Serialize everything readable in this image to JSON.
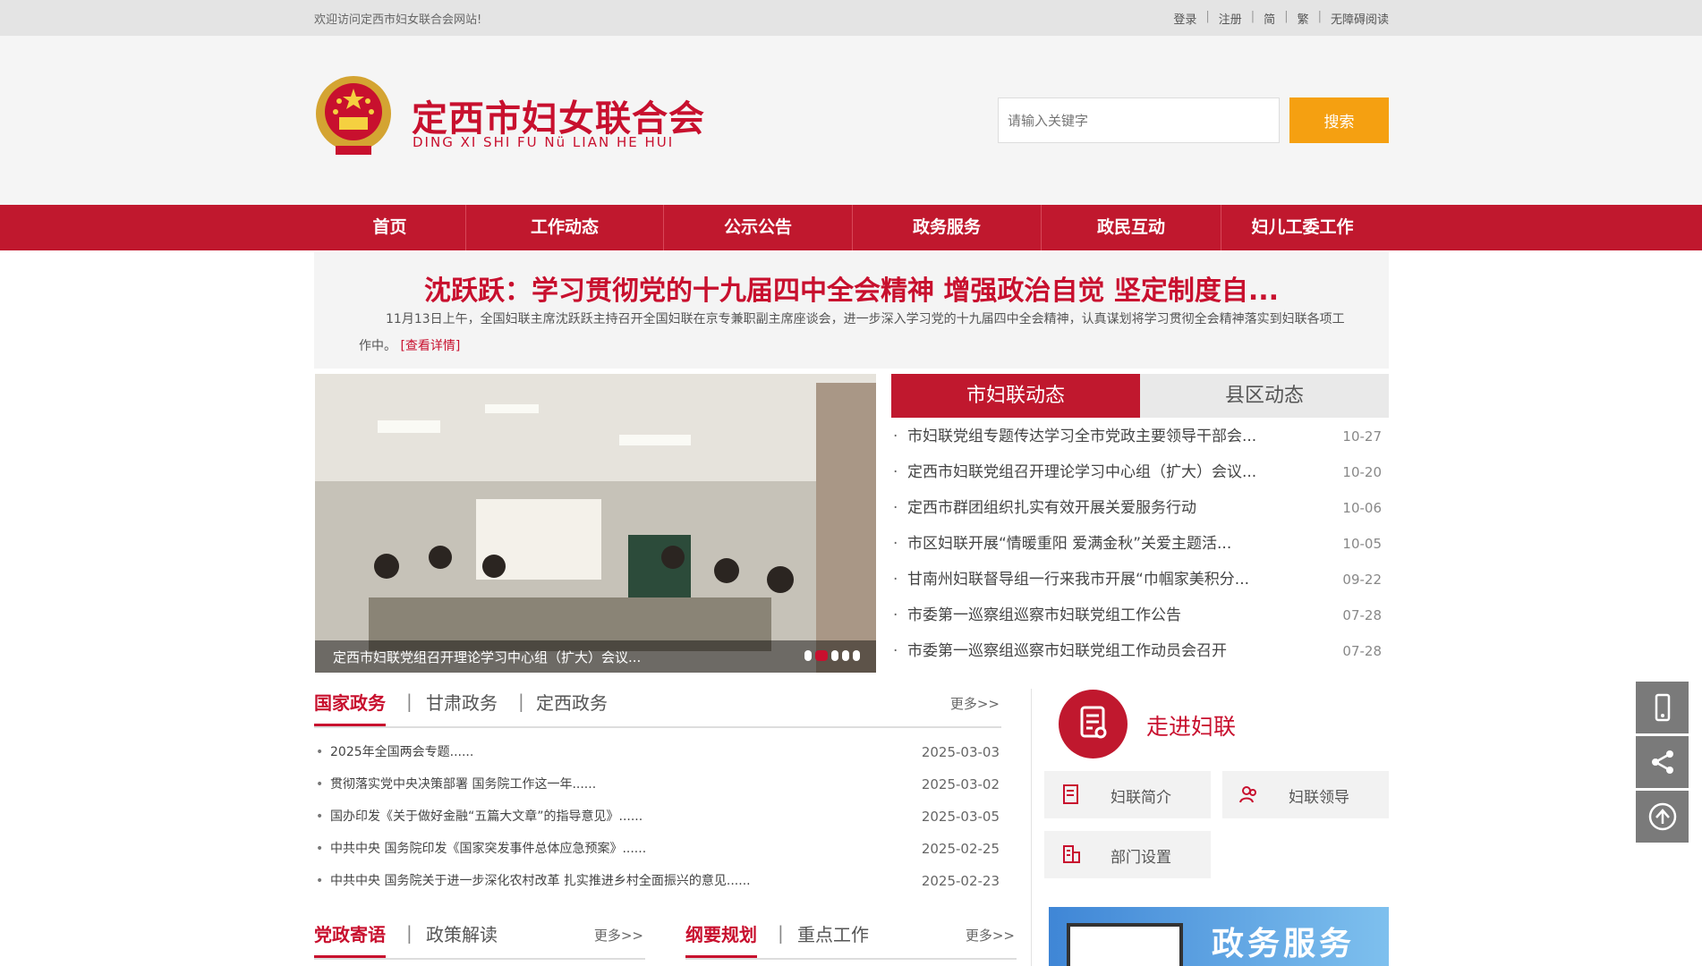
{
  "topbar": {
    "welcome": "欢迎访问定西市妇女联合会网站!",
    "links": [
      "登录",
      "注册",
      "简",
      "繁",
      "无障碍阅读"
    ]
  },
  "header": {
    "title": "定西市妇女联合会",
    "subtitle": "DING XI SHI FU Nü LIAN HE HUI",
    "search_placeholder": "请输入关键字",
    "search_button": "搜索"
  },
  "nav": {
    "items": [
      "首页",
      "工作动态",
      "公示公告",
      "政务服务",
      "政民互动",
      "妇儿工委工作"
    ]
  },
  "headline": {
    "title": "沈跃跃：学习贯彻党的十九届四中全会精神 增强政治自觉 坚定制度自...",
    "summary": "11月13日上午，全国妇联主席沈跃跃主持召开全国妇联在京专兼职副主席座谈会，进一步深入学习党的十九届四中全会精神，认真谋划将学习贯彻全会精神落实到妇联各项工作中。",
    "more": "[查看详情]"
  },
  "slider": {
    "caption": "定西市妇联党组召开理论学习中心组（扩大）会议..."
  },
  "news_tabs": {
    "tabs": [
      "市妇联动态",
      "县区动态"
    ],
    "items": [
      {
        "title": "市妇联党组专题传达学习全市党政主要领导干部会...",
        "date": "10-27"
      },
      {
        "title": "定西市妇联党组召开理论学习中心组（扩大）会议...",
        "date": "10-20"
      },
      {
        "title": "定西市群团组织扎实有效开展关爱服务行动",
        "date": "10-06"
      },
      {
        "title": "市区妇联开展“情暖重阳 爱满金秋”关爱主题活...",
        "date": "10-05"
      },
      {
        "title": "甘南州妇联督导组一行来我市开展“巾帼家美积分...",
        "date": "09-22"
      },
      {
        "title": "市委第一巡察组巡察市妇联党组工作公告",
        "date": "07-28"
      },
      {
        "title": "市委第一巡察组巡察市妇联党组工作动员会召开",
        "date": "07-28"
      }
    ]
  },
  "gov": {
    "tabs": [
      "国家政务",
      "甘肃政务",
      "定西政务"
    ],
    "more": "更多>>",
    "items": [
      {
        "title": "2025年全国两会专题......",
        "date": "2025-03-03"
      },
      {
        "title": "贯彻落实党中央决策部署 国务院工作这一年......",
        "date": "2025-03-02"
      },
      {
        "title": "国办印发《关于做好金融“五篇大文章”的指导意见》......",
        "date": "2025-03-05"
      },
      {
        "title": "中共中央  国务院印发《国家突发事件总体应急预案》......",
        "date": "2025-02-25"
      },
      {
        "title": "中共中央 国务院关于进一步深化农村改革 扎实推进乡村全面振兴的意见......",
        "date": "2025-02-23"
      }
    ]
  },
  "bottom": {
    "left_tabs": [
      "党政寄语",
      "政策解读"
    ],
    "right_tabs": [
      "纲要规划",
      "重点工作"
    ],
    "more": "更多>>"
  },
  "zoujin": {
    "title": "走进妇联",
    "buttons": [
      "妇联简介",
      "妇联领导",
      "部门设置"
    ]
  },
  "gov_service": {
    "label": "政务服务"
  },
  "colors": {
    "brand_red": "#c0182e",
    "accent_orange": "#f5a011"
  }
}
